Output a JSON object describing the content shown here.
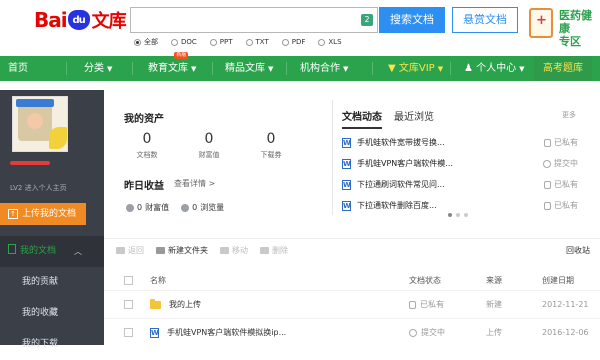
{
  "header": {
    "logo": {
      "bai": "Bai",
      "du": "du",
      "wenku": "文库"
    },
    "search": {
      "value": "",
      "badge": "2"
    },
    "search_button": "搜索文档",
    "reward_button": "悬赏文档",
    "promo": {
      "line1": "医药健康",
      "line2": "专区"
    },
    "filters": [
      {
        "label": "全部",
        "selected": true
      },
      {
        "label": "DOC",
        "selected": false
      },
      {
        "label": "PPT",
        "selected": false
      },
      {
        "label": "TXT",
        "selected": false
      },
      {
        "label": "PDF",
        "selected": false
      },
      {
        "label": "XLS",
        "selected": false
      }
    ]
  },
  "nav": {
    "items": [
      {
        "label": "首页"
      },
      {
        "label": "分类"
      },
      {
        "label": "教育文库",
        "badge": "新版"
      },
      {
        "label": "精品文库"
      },
      {
        "label": "机构合作"
      },
      {
        "label": "文库VIP"
      },
      {
        "label": "个人中心"
      },
      {
        "label": "高考题库"
      }
    ]
  },
  "sidebar": {
    "level_text": "LV2  进入个人主页",
    "upload_button": "上传我的文档",
    "menu": [
      {
        "label": "我的文档"
      },
      {
        "label": "我的贡献"
      },
      {
        "label": "我的收藏"
      },
      {
        "label": "我的下载"
      }
    ]
  },
  "assets": {
    "title": "我的资产",
    "items": [
      {
        "value": "0",
        "label": "文档数"
      },
      {
        "value": "0",
        "label": "财富值"
      },
      {
        "value": "0",
        "label": "下载券"
      }
    ]
  },
  "earnings": {
    "title": "昨日收益",
    "detail_link": "查看详情 >",
    "items": [
      {
        "value": "0",
        "label": "财富值"
      },
      {
        "value": "0",
        "label": "浏览量"
      }
    ]
  },
  "activity": {
    "tabs": [
      {
        "label": "文档动态"
      },
      {
        "label": "最近浏览"
      }
    ],
    "more": "更多",
    "rows": [
      {
        "title": "手机蛙软件宽带拔号换...",
        "status": "已私有"
      },
      {
        "title": "手机蛙VPN客户端软件模...",
        "status": "提交中"
      },
      {
        "title": "下拉通刷词软件常见问...",
        "status": "已私有"
      },
      {
        "title": "下拉通软件删除百度...",
        "status": "已私有"
      }
    ]
  },
  "toolbar": {
    "items": [
      {
        "label": "返回",
        "enabled": false
      },
      {
        "label": "新建文件夹",
        "enabled": true
      },
      {
        "label": "移动",
        "enabled": false
      },
      {
        "label": "删除",
        "enabled": false
      }
    ],
    "recycle": "回收站"
  },
  "table": {
    "headers": {
      "name": "名称",
      "status": "文档状态",
      "source": "来源",
      "date": "创建日期"
    },
    "rows": [
      {
        "name": "我的上传",
        "type": "folder",
        "status": "已私有",
        "source": "新建",
        "date": "2012-11-21"
      },
      {
        "name": "手机蛙VPN客户端软件模拟换ip...",
        "type": "word",
        "status": "提交中",
        "source": "上传",
        "date": "2016-12-06"
      }
    ]
  }
}
